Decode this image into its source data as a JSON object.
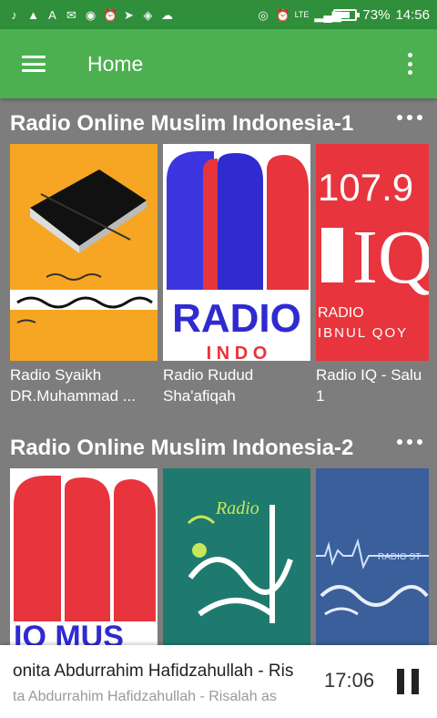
{
  "status_bar": {
    "battery": "73%",
    "battery_level": 0.73,
    "time": "14:56",
    "network": "LTE",
    "icons_left": [
      "music-note-icon",
      "warning-icon",
      "a-icon",
      "gmail-icon",
      "record-icon",
      "alarm-icon",
      "telegram-icon",
      "layers-icon",
      "cloud-icon"
    ],
    "icons_right": [
      "hotspot-icon",
      "alarm-icon",
      "signal-icon",
      "battery-icon"
    ]
  },
  "appbar": {
    "title": "Home"
  },
  "sections": [
    {
      "title": "Radio Online Muslim Indonesia-1",
      "cards": [
        {
          "line1": "Radio Syaikh",
          "line2": "DR.Muhammad ..."
        },
        {
          "line1": "Radio Rudud",
          "line2": "Sha'afiqah"
        },
        {
          "line1": "Radio IQ - Salu",
          "line2": "1"
        }
      ]
    },
    {
      "title": "Radio Online Muslim Indonesia-2",
      "cards": [
        {
          "line1": "",
          "line2": ""
        },
        {
          "line1": "",
          "line2": ""
        },
        {
          "line1": "",
          "line2": ""
        }
      ]
    }
  ],
  "artwork_text": {
    "radio_indo_word": "RADIO",
    "radio_indo_sub": "I N D O",
    "iq_freq": "107.9",
    "iq_logo": "IQ",
    "iq_radio": "RADIO",
    "iq_name": "IBNUL QOY",
    "io_mus": "IO MUS",
    "sunnah_radio": "Radio",
    "radio_st": "RADIO ST"
  },
  "player": {
    "title": "onita Abdurrahim Hafidzahullah - Ris",
    "subtitle": "ta Abdurrahim Hafidzahullah - Risalah as",
    "time": "17:06"
  },
  "colors": {
    "status_bar": "#2f8f3a",
    "appbar": "#4cb050",
    "background": "#7d7d7d"
  }
}
